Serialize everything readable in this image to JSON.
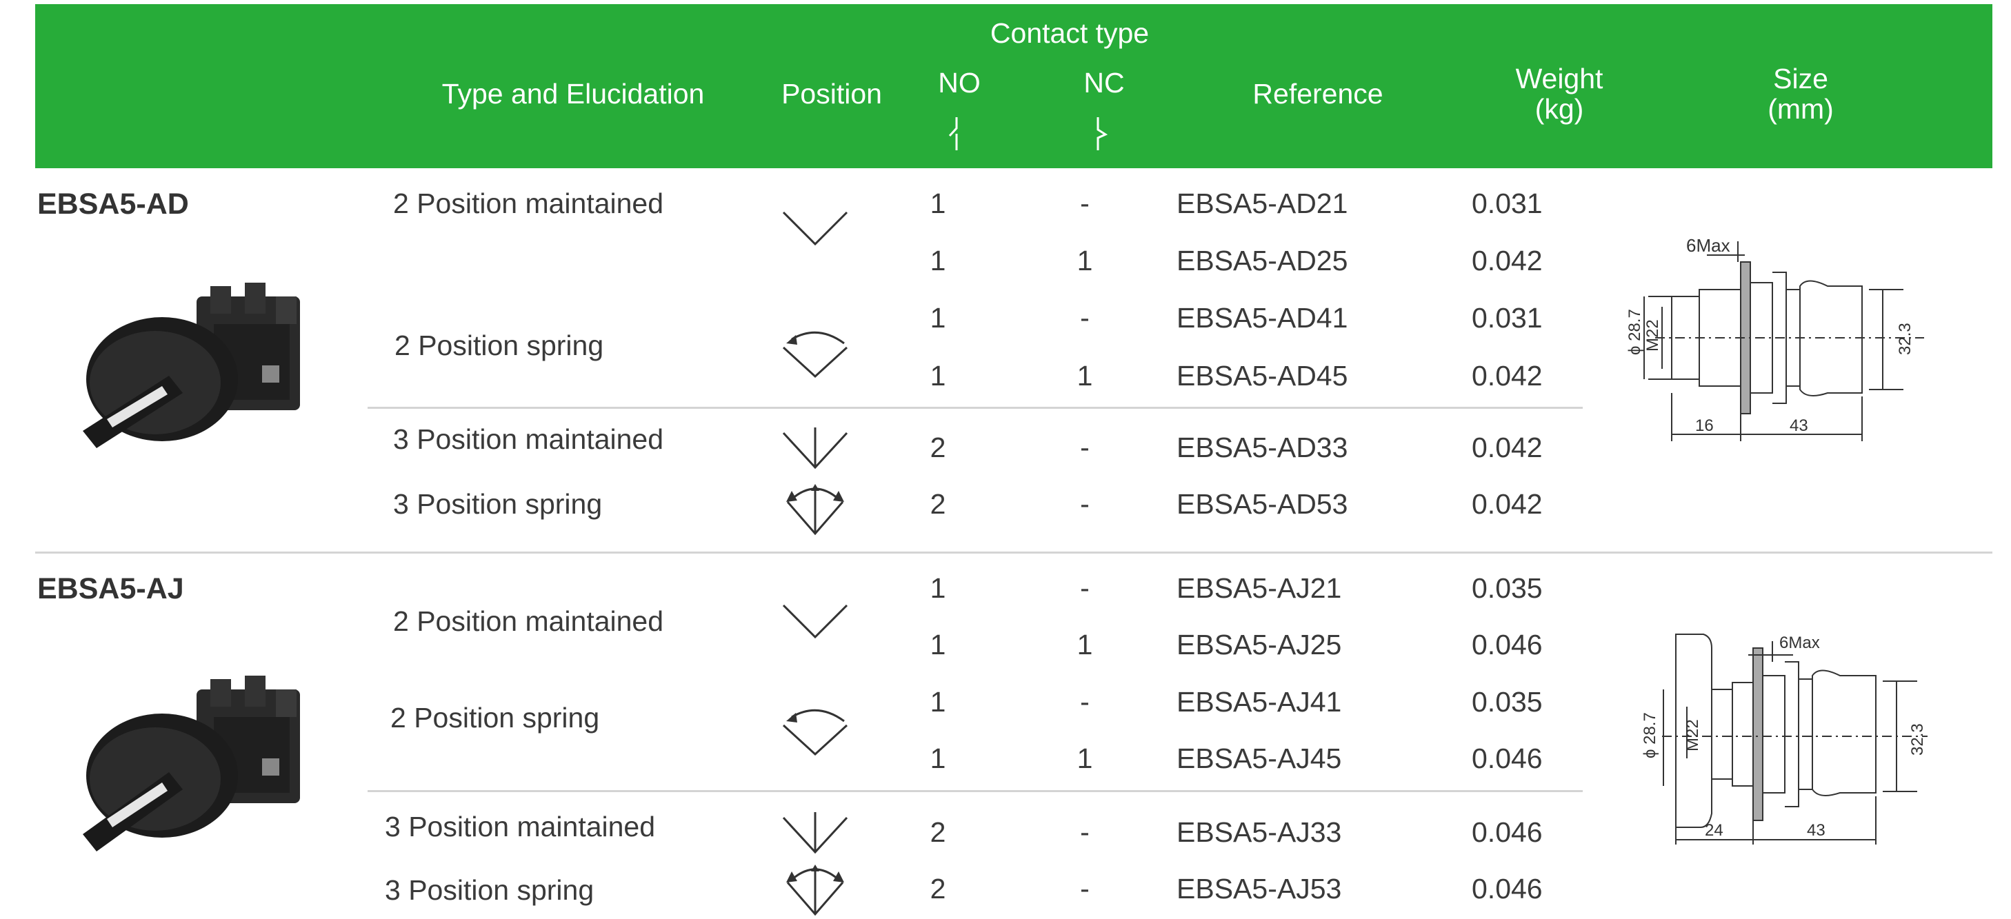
{
  "header": {
    "contact_type": "Contact type",
    "type": "Type and Elucidation",
    "position": "Position",
    "no": "NO",
    "nc": "NC",
    "reference": "Reference",
    "weight_1": "Weight",
    "weight_2": "(kg)",
    "size_1": "Size",
    "size_2": "(mm)",
    "background": "#27ac39"
  },
  "groups": [
    {
      "series": "EBSA5-AD",
      "types": [
        "2 Position maintained",
        "2 Position spring",
        "3 Position maintained",
        "3 Position spring"
      ],
      "rows": [
        {
          "no": "1",
          "nc": "-",
          "ref": "EBSA5-AD21",
          "weight": "0.031"
        },
        {
          "no": "1",
          "nc": "1",
          "ref": "EBSA5-AD25",
          "weight": "0.042"
        },
        {
          "no": "1",
          "nc": "-",
          "ref": "EBSA5-AD41",
          "weight": "0.031"
        },
        {
          "no": "1",
          "nc": "1",
          "ref": "EBSA5-AD45",
          "weight": "0.042"
        },
        {
          "no": "2",
          "nc": "-",
          "ref": "EBSA5-AD33",
          "weight": "0.042"
        },
        {
          "no": "2",
          "nc": "-",
          "ref": "EBSA5-AD53",
          "weight": "0.042"
        }
      ],
      "drawing": {
        "max": "6Max",
        "dia": "ϕ 28.7",
        "thread": "M22",
        "height": "32.3",
        "w1": "16",
        "w2": "43"
      }
    },
    {
      "series": "EBSA5-AJ",
      "types": [
        "2 Position maintained",
        "2 Position spring",
        "3 Position maintained",
        "3 Position spring"
      ],
      "rows": [
        {
          "no": "1",
          "nc": "-",
          "ref": "EBSA5-AJ21",
          "weight": "0.035"
        },
        {
          "no": "1",
          "nc": "1",
          "ref": "EBSA5-AJ25",
          "weight": "0.046"
        },
        {
          "no": "1",
          "nc": "-",
          "ref": "EBSA5-AJ41",
          "weight": "0.035"
        },
        {
          "no": "1",
          "nc": "1",
          "ref": "EBSA5-AJ45",
          "weight": "0.046"
        },
        {
          "no": "2",
          "nc": "-",
          "ref": "EBSA5-AJ33",
          "weight": "0.046"
        },
        {
          "no": "2",
          "nc": "-",
          "ref": "EBSA5-AJ53",
          "weight": "0.046"
        }
      ],
      "drawing": {
        "max": "6Max",
        "dia": "ϕ 28.7",
        "thread": "M22",
        "height": "32.3",
        "w1": "24",
        "w2": "43"
      }
    }
  ]
}
